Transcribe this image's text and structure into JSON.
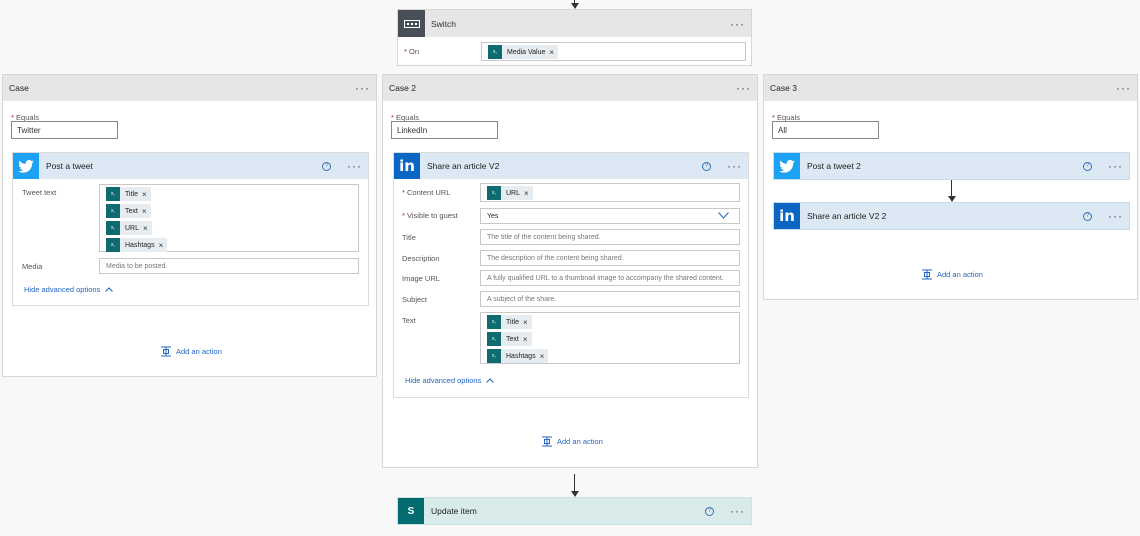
{
  "switch": {
    "title": "Switch",
    "on_label": "On",
    "on_token": "Media Value"
  },
  "cases": [
    {
      "title": "Case",
      "equals_label": "Equals",
      "equals_value": "Twitter",
      "action": {
        "title": "Post a tweet",
        "tweet_text_label": "Tweet text",
        "tokens": [
          "Title",
          "Text",
          "URL",
          "Hashtags"
        ],
        "media_label": "Media",
        "media_placeholder": "Media to be posted.",
        "hide_advanced": "Hide advanced options"
      },
      "add_action": "Add an action"
    },
    {
      "title": "Case 2",
      "equals_label": "Equals",
      "equals_value": "LinkedIn",
      "action": {
        "title": "Share an article V2",
        "content_url_label": "Content URL",
        "content_url_token": "URL",
        "visible_label": "Visible to guest",
        "visible_value": "Yes",
        "title_label": "Title",
        "title_placeholder": "The title of the content being shared.",
        "description_label": "Description",
        "description_placeholder": "The description of the content being shared.",
        "image_url_label": "Image URL",
        "image_url_placeholder": "A fully qualified URL to a thumbnail image to accompany the shared content.",
        "subject_label": "Subject",
        "subject_placeholder": "A subject of the share.",
        "text_label": "Text",
        "tokens": [
          "Title",
          "Text",
          "Hashtags"
        ],
        "hide_advanced": "Hide advanced options"
      },
      "add_action": "Add an action"
    },
    {
      "title": "Case 3",
      "equals_label": "Equals",
      "equals_value": "All",
      "action1": {
        "title": "Post a tweet 2"
      },
      "action2": {
        "title": "Share an article V2 2"
      },
      "add_action": "Add an action"
    }
  ],
  "update_item": {
    "title": "Update item"
  },
  "colors": {
    "twitter": "#1da1f2",
    "linkedin": "#0a66c2",
    "sharepoint": "#036c70",
    "token": "#0e6b6f",
    "link": "#2266c4"
  },
  "icons": [
    "switch-icon",
    "twitter-icon",
    "linkedin-icon",
    "sharepoint-icon",
    "help-icon",
    "more-icon",
    "chevron-up-icon",
    "chevron-down-icon",
    "add-action-icon",
    "dynamic-content-icon",
    "remove-icon",
    "arrow-down-icon"
  ]
}
